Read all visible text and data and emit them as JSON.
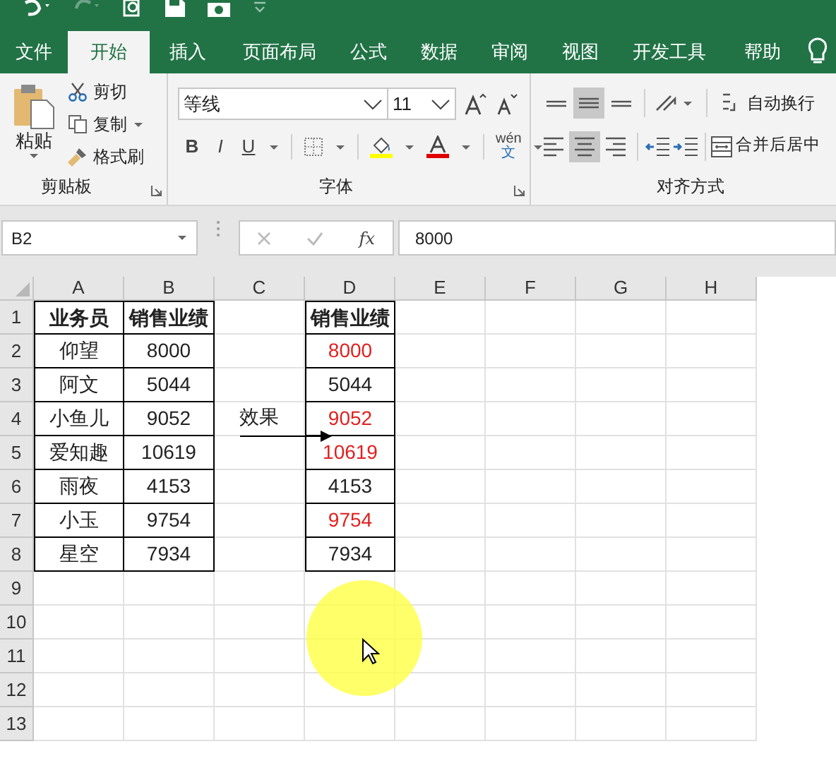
{
  "ribbon_tabs": [
    {
      "label": "文件",
      "selected": false
    },
    {
      "label": "开始",
      "selected": true
    },
    {
      "label": "插入",
      "selected": false
    },
    {
      "label": "页面布局",
      "selected": false
    },
    {
      "label": "公式",
      "selected": false
    },
    {
      "label": "数据",
      "selected": false
    },
    {
      "label": "审阅",
      "selected": false
    },
    {
      "label": "视图",
      "selected": false
    },
    {
      "label": "开发工具",
      "selected": false
    },
    {
      "label": "帮助",
      "selected": false
    }
  ],
  "clipboard": {
    "paste": "粘贴",
    "actions": [
      "剪切",
      "复制",
      "格式刷"
    ],
    "group_label": "剪贴板"
  },
  "font": {
    "font_name": "等线",
    "font_size": "11",
    "bold": "B",
    "italic": "I",
    "underline": "U",
    "phonetic_top": "wén",
    "phonetic_bottom": "文",
    "group_label": "字体"
  },
  "alignment": {
    "vertical": [
      {
        "kind": "top",
        "selected": false
      },
      {
        "kind": "middle",
        "selected": true
      },
      {
        "kind": "bottom",
        "selected": false
      }
    ],
    "horizontal": [
      {
        "kind": "left",
        "selected": false
      },
      {
        "kind": "center",
        "selected": true
      },
      {
        "kind": "right",
        "selected": false
      }
    ],
    "wrap_text": "自动换行",
    "merge_center": "合并后居中",
    "group_label": "对齐方式"
  },
  "formula_bar": {
    "name_box": "B2",
    "fx": "fx",
    "value": "8000"
  },
  "sheet": {
    "columns": [
      "A",
      "B",
      "C",
      "D",
      "E",
      "F",
      "G",
      "H"
    ],
    "row_numbers": [
      "1",
      "2",
      "3",
      "4",
      "5",
      "6",
      "7",
      "8",
      "9",
      "10",
      "11",
      "12",
      "13"
    ],
    "source_headers": [
      "业务员",
      "销售业绩"
    ],
    "source_rows": [
      {
        "name": "仰望",
        "sales": "8000"
      },
      {
        "name": "阿文",
        "sales": "5044"
      },
      {
        "name": "小鱼儿",
        "sales": "9052"
      },
      {
        "name": "爱知趣",
        "sales": "10619"
      },
      {
        "name": "雨夜",
        "sales": "4153"
      },
      {
        "name": "小玉",
        "sales": "9754"
      },
      {
        "name": "星空",
        "sales": "7934"
      }
    ],
    "arrow_label": "效果",
    "result_header": "销售业绩",
    "result_rows": [
      {
        "value": "8000",
        "highlighted": true
      },
      {
        "value": "5044",
        "highlighted": false
      },
      {
        "value": "9052",
        "highlighted": true
      },
      {
        "value": "10619",
        "highlighted": true
      },
      {
        "value": "4153",
        "highlighted": false
      },
      {
        "value": "9754",
        "highlighted": true
      },
      {
        "value": "7934",
        "highlighted": false
      }
    ]
  }
}
